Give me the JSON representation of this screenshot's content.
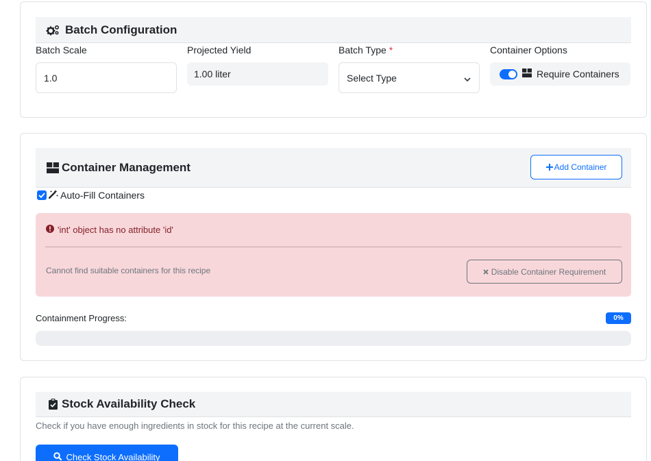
{
  "batch_config": {
    "title": "Batch Configuration",
    "icon": "gears-icon",
    "batch_scale_label": "Batch Scale",
    "batch_scale_value": "1.0",
    "projected_yield_label": "Projected Yield",
    "projected_yield_value": "1.00 liter",
    "batch_type_label": "Batch Type",
    "required_marker": "*",
    "batch_type_value": "Select Type",
    "container_options_label": "Container Options",
    "require_containers_label": "Require Containers",
    "require_containers_on": true
  },
  "container_mgmt": {
    "title": "Container Management",
    "icon": "boxes-icon",
    "add_button_label": "Add Container",
    "autofill_label": "Auto-Fill Containers",
    "autofill_checked": true,
    "error_message": "'int' object has no attribute 'id'",
    "hint": "Cannot find suitable containers for this recipe",
    "disable_button_label": "Disable Container Requirement",
    "progress_label": "Containment Progress:",
    "progress_badge": "0%",
    "progress_value": 0
  },
  "stock_check": {
    "title": "Stock Availability Check",
    "icon": "clipboard-check-icon",
    "description": "Check if you have enough ingredients in stock for this recipe at the current scale.",
    "button_label": "Check Stock Availability"
  },
  "colors": {
    "primary": "#0d6efd",
    "danger_bg": "#f8d7da",
    "danger_text": "#842029",
    "secondary": "#6c757d",
    "header_bg": "#f3f4f6"
  }
}
